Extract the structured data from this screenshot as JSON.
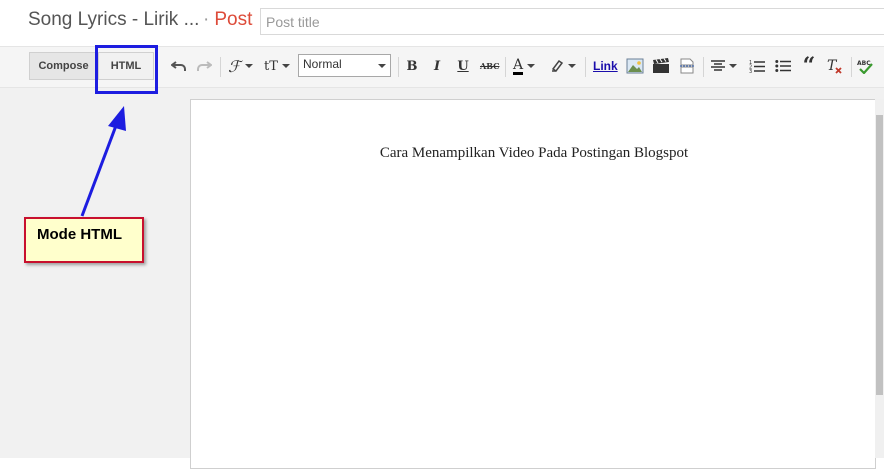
{
  "header": {
    "blog_name": "Song Lyrics - Lirik ...",
    "separator": "·",
    "post_label": "Post",
    "title_placeholder": "Post title"
  },
  "toolbar": {
    "compose_label": "Compose",
    "html_label": "HTML",
    "font_icon": "ℱ",
    "font_size_icon": "tT",
    "format_value": "Normal",
    "bold": "B",
    "italic": "I",
    "underline": "U",
    "strikethrough": "ABC",
    "text_color": "A",
    "link_label": "Link",
    "blockquote": "“"
  },
  "editor": {
    "content": "Cara Menampilkan Video Pada Postingan Blogspot"
  },
  "annotation": {
    "label": "Mode HTML"
  },
  "colors": {
    "post_accent": "#dd4b39",
    "annotation_border": "#c8102e",
    "annotation_fill": "#ffffcc",
    "highlight": "#1d1de0",
    "link": "#1a0dab"
  }
}
